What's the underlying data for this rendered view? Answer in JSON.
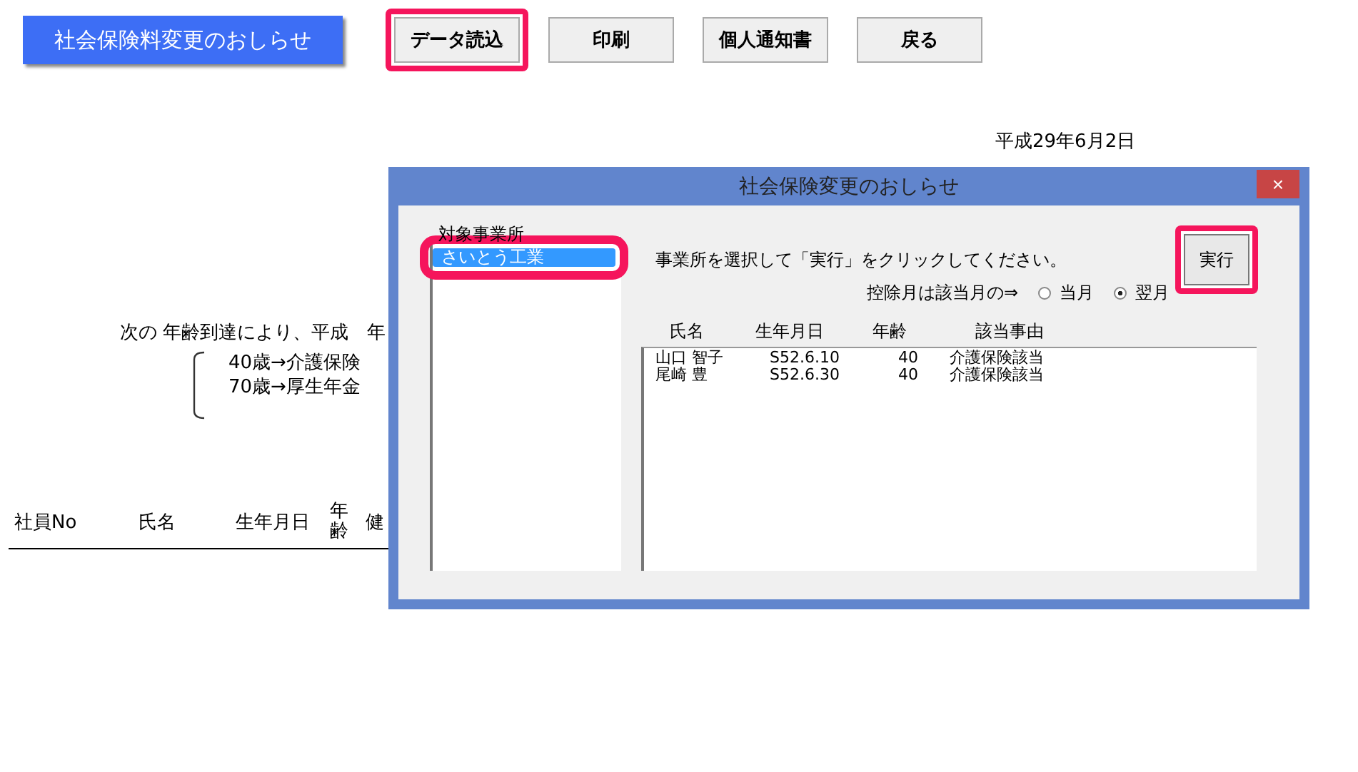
{
  "sheet": {
    "title_button": "社会保険料変更のおしらせ",
    "buttons": [
      {
        "label": "データ読込",
        "highlighted": true
      },
      {
        "label": "印刷",
        "highlighted": false
      },
      {
        "label": "個人通知書",
        "highlighted": false
      },
      {
        "label": "戻る",
        "highlighted": false
      }
    ],
    "date": "平成29年6月2日",
    "notice": "次の 年齢到達により、平成　年",
    "notes": [
      "40歳→介護保険",
      "70歳→厚生年金"
    ],
    "columns": [
      "社員No",
      "氏名",
      "生年月日",
      "年齢",
      "健"
    ]
  },
  "dialog": {
    "title": "社会保険変更のおしらせ",
    "close": "×",
    "list_label": "対象事業所",
    "offices": [
      {
        "label": "さいとう工業",
        "selected": true,
        "highlighted": true
      }
    ],
    "instruction": "事業所を選択して「実行」をクリックしてください。",
    "deduction_label": "控除月は該当月の⇒",
    "months": [
      {
        "label": "当月",
        "selected": false
      },
      {
        "label": "翌月",
        "selected": true
      }
    ],
    "run_button": {
      "label": "実行",
      "highlighted": true
    },
    "columns": [
      "氏名",
      "生年月日",
      "年齢",
      "該当事由"
    ],
    "rows": [
      [
        "山口 智子",
        "S52.6.10",
        "40",
        "介護保険該当"
      ],
      [
        "尾崎 豊",
        "S52.6.30",
        "40",
        "介護保険該当"
      ]
    ]
  }
}
